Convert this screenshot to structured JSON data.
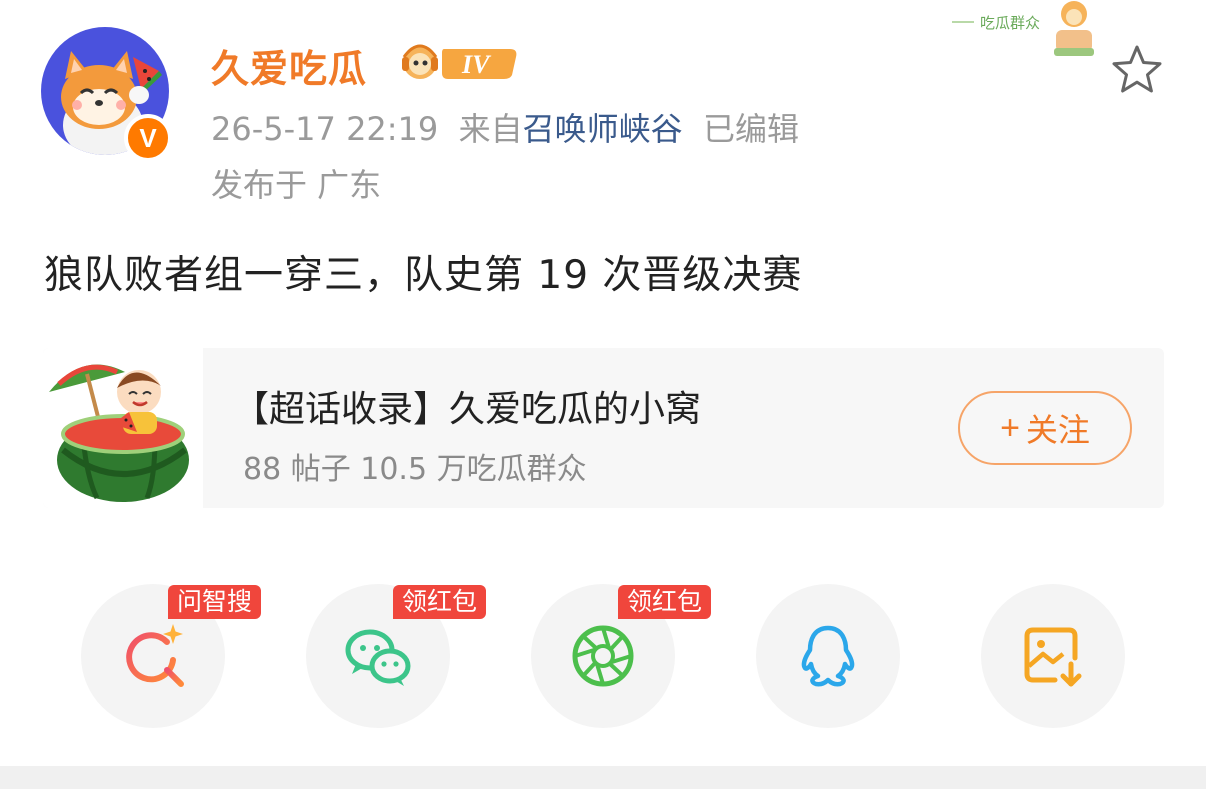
{
  "post": {
    "username": "久爱吃瓜",
    "timestamp": "26-5-17 22:19",
    "source_prefix": "来自",
    "source_name": "召唤师峡谷",
    "edited": "已编辑",
    "location": "发布于 广东",
    "text": "狼队败者组一穿三，队史第 19 次晋级决赛",
    "vip_level": "IV",
    "verify_mark": "V"
  },
  "topic_card": {
    "title": "【超话收录】久爱吃瓜的小窝",
    "stats": "88 帖子 10.5 万吃瓜群众",
    "follow_plus": "+",
    "follow_label": "关注"
  },
  "decor": {
    "corner_text": "吃瓜群众"
  },
  "share": [
    {
      "name": "ai-search",
      "tag": "问智搜",
      "icon": "ai-search-icon",
      "color": "#ee4466"
    },
    {
      "name": "wechat",
      "tag": "领红包",
      "icon": "wechat-icon",
      "color": "#3cc58a"
    },
    {
      "name": "moments",
      "tag": "领红包",
      "icon": "moments-icon",
      "color": "#4cbf4c"
    },
    {
      "name": "qq",
      "tag": "",
      "icon": "qq-icon",
      "color": "#2ba7ea"
    },
    {
      "name": "save-image",
      "tag": "",
      "icon": "save-image-icon",
      "color": "#f5a623"
    }
  ],
  "colors": {
    "username": "#f07a28",
    "source_link": "#3a5a8c",
    "tag_bg": "#f0463c"
  }
}
